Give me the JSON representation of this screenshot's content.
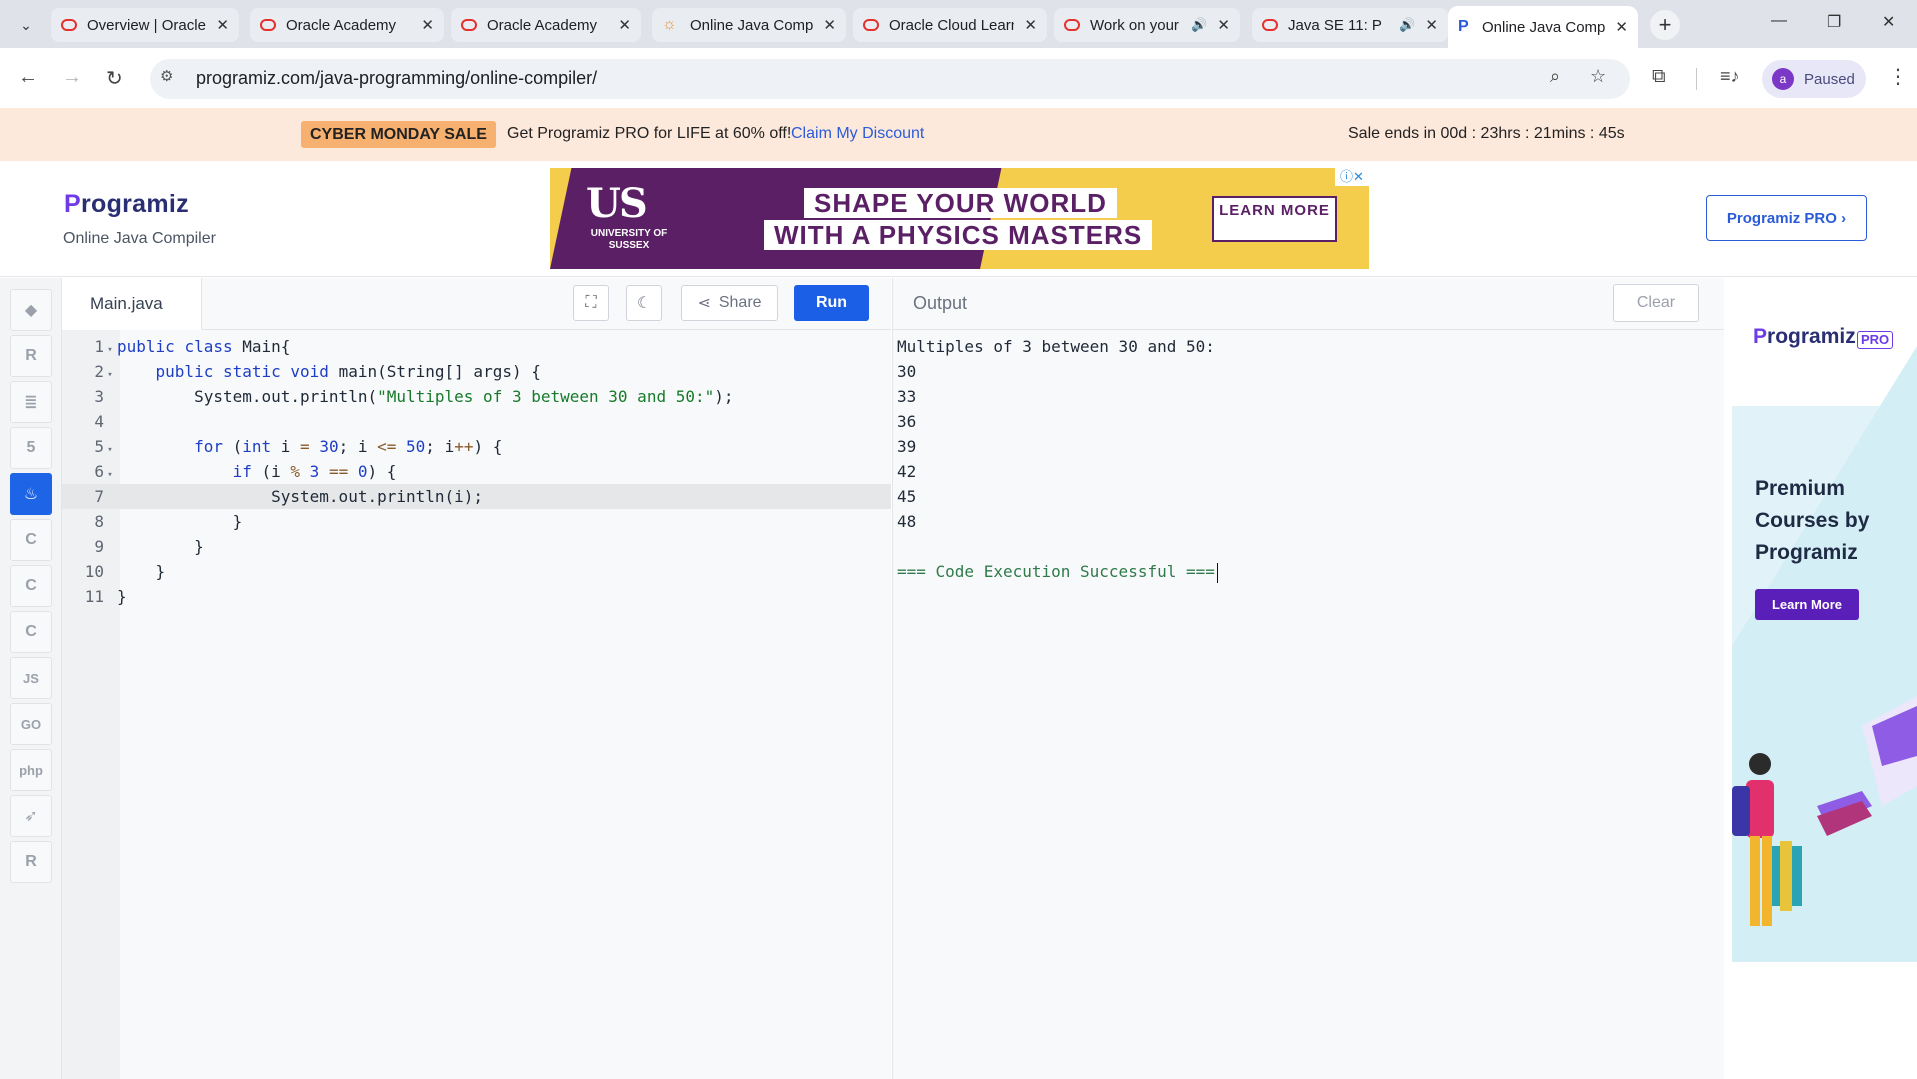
{
  "browser": {
    "tabs": [
      {
        "title": "Overview | Oracle",
        "favicon": "oracle-icon",
        "active": false
      },
      {
        "title": "Oracle Academy",
        "favicon": "oracle-icon",
        "active": false
      },
      {
        "title": "Oracle Academy",
        "favicon": "oracle-icon",
        "active": false
      },
      {
        "title": "Online Java Compiler",
        "favicon": "sun-icon",
        "active": false
      },
      {
        "title": "Oracle Cloud Learning",
        "favicon": "oracle-icon",
        "active": false
      },
      {
        "title": "Work on your",
        "favicon": "oracle-icon",
        "active": false,
        "audio": true
      },
      {
        "title": "Java SE 11: P",
        "favicon": "oracle-icon",
        "active": false,
        "audio": true
      },
      {
        "title": "Online Java Compiler",
        "favicon": "programiz-icon",
        "active": true
      }
    ],
    "url": "programiz.com/java-programming/online-compiler/",
    "profile_initial": "a",
    "profile_label": "Paused"
  },
  "promo": {
    "badge": "CYBER MONDAY SALE",
    "text": "Get Programiz PRO for LIFE at 60% off!",
    "link": "Claim My Discount",
    "timer": "Sale ends in 00d : 23hrs : 21mins : 45s"
  },
  "header": {
    "logo": "rogramiz",
    "logo_initial": "P",
    "subtitle": "Online Java Compiler",
    "pro_button": "Programiz PRO ›"
  },
  "ad_banner": {
    "logo": "US",
    "university": "UNIVERSITY OF SUSSEX",
    "headline_1": "SHAPE YOUR WORLD",
    "headline_2": "WITH A PHYSICS MASTERS",
    "cta": "LEARN MORE",
    "choices": "ⓘ✕",
    "colors": {
      "purple": "#5a1f64",
      "yellow": "#f5cd4d"
    }
  },
  "sidebar": {
    "items": [
      {
        "name": "python",
        "glyph": "◆"
      },
      {
        "name": "r",
        "glyph": "R"
      },
      {
        "name": "sql",
        "glyph": "≣"
      },
      {
        "name": "html",
        "glyph": "5"
      },
      {
        "name": "java",
        "glyph": "♨",
        "active": true
      },
      {
        "name": "c",
        "glyph": "C"
      },
      {
        "name": "cpp",
        "glyph": "C"
      },
      {
        "name": "csharp",
        "glyph": "C"
      },
      {
        "name": "js",
        "glyph": "JS"
      },
      {
        "name": "go",
        "glyph": "GO"
      },
      {
        "name": "php",
        "glyph": "php"
      },
      {
        "name": "swift",
        "glyph": "➶"
      },
      {
        "name": "rust",
        "glyph": "R"
      }
    ]
  },
  "editor": {
    "file_tab": "Main.java",
    "share_label": "Share",
    "run_label": "Run",
    "lines": [
      {
        "n": "1",
        "fold": "▾",
        "code": "public class Main{"
      },
      {
        "n": "2",
        "fold": "▾",
        "code": "    public static void main(String[] args) {"
      },
      {
        "n": "3",
        "fold": "",
        "code": "        System.out.println(\"Multiples of 3 between 30 and 50:\");"
      },
      {
        "n": "4",
        "fold": "",
        "code": ""
      },
      {
        "n": "5",
        "fold": "▾",
        "code": "        for (int i = 30; i <= 50; i++) {"
      },
      {
        "n": "6",
        "fold": "▾",
        "code": "            if (i % 3 == 0) {"
      },
      {
        "n": "7",
        "fold": "",
        "code": "                System.out.println(i);",
        "highlight": true
      },
      {
        "n": "8",
        "fold": "",
        "code": "            }"
      },
      {
        "n": "9",
        "fold": "",
        "code": "        }"
      },
      {
        "n": "10",
        "fold": "",
        "code": "    }"
      },
      {
        "n": "11",
        "fold": "",
        "code": "}"
      }
    ]
  },
  "output": {
    "title": "Output",
    "clear_label": "Clear",
    "lines": [
      "Multiples of 3 between 30 and 50:",
      "30",
      "33",
      "36",
      "39",
      "42",
      "45",
      "48",
      "",
      "=== Code Execution Successful ==="
    ]
  },
  "side_ad": {
    "logo": "rogramiz",
    "logo_initial": "P",
    "pro_tag": "PRO",
    "title": "Premium Courses by Programiz",
    "button": "Learn More"
  },
  "colors": {
    "accent": "#1a5fe6",
    "promo_bg": "#fde8dc",
    "badge": "#f6b070"
  }
}
